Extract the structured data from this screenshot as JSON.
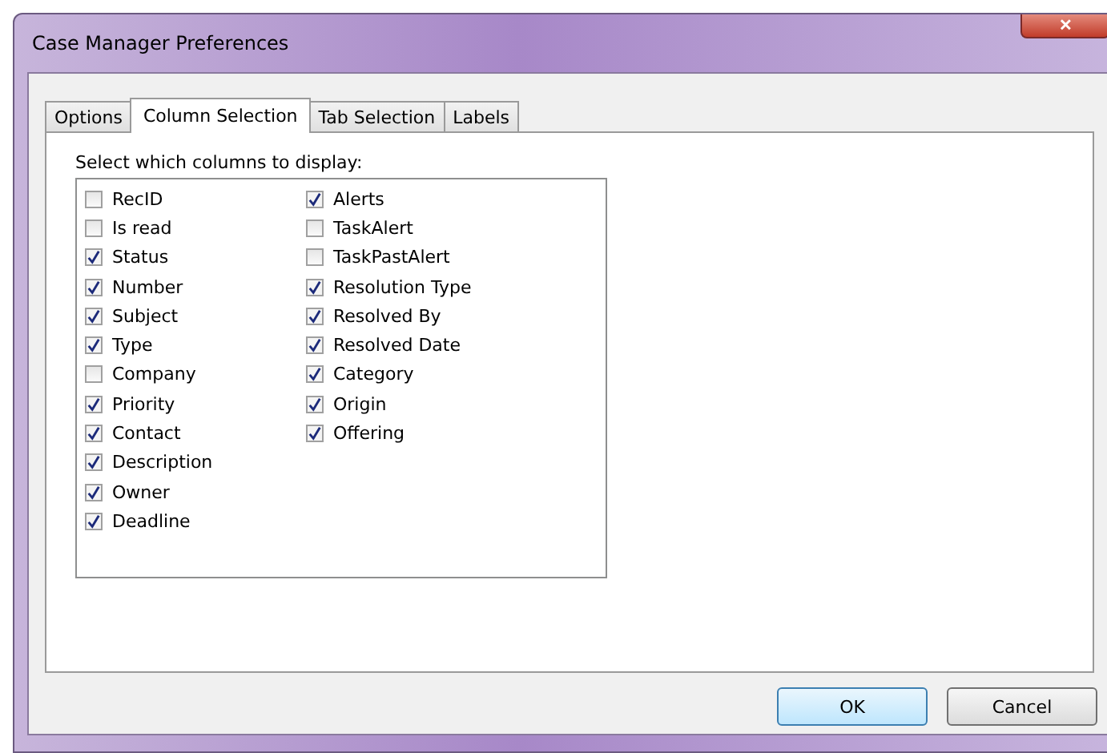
{
  "window": {
    "title": "Case Manager Preferences",
    "close": "✕"
  },
  "tabs": [
    {
      "label": "Options",
      "selected": false
    },
    {
      "label": "Column Selection",
      "selected": true
    },
    {
      "label": "Tab Selection",
      "selected": false
    },
    {
      "label": "Labels",
      "selected": false
    }
  ],
  "prompt": "Select which columns to display:",
  "columns": [
    [
      {
        "label": "RecID",
        "checked": false
      },
      {
        "label": "Is read",
        "checked": false
      },
      {
        "label": "Status",
        "checked": true
      },
      {
        "label": "Number",
        "checked": true
      },
      {
        "label": "Subject",
        "checked": true
      },
      {
        "label": "Type",
        "checked": true
      },
      {
        "label": "Company",
        "checked": false
      },
      {
        "label": "Priority",
        "checked": true
      },
      {
        "label": "Contact",
        "checked": true
      },
      {
        "label": "Description",
        "checked": true
      },
      {
        "label": "Owner",
        "checked": true
      },
      {
        "label": "Deadline",
        "checked": true
      }
    ],
    [
      {
        "label": "Alerts",
        "checked": true
      },
      {
        "label": "TaskAlert",
        "checked": false
      },
      {
        "label": "TaskPastAlert",
        "checked": false
      },
      {
        "label": "Resolution Type",
        "checked": true
      },
      {
        "label": "Resolved By",
        "checked": true
      },
      {
        "label": "Resolved Date",
        "checked": true
      },
      {
        "label": "Category",
        "checked": true
      },
      {
        "label": "Origin",
        "checked": true
      },
      {
        "label": "Offering",
        "checked": true
      }
    ]
  ],
  "buttons": [
    {
      "label": "OK",
      "kind": "default"
    },
    {
      "label": "Cancel",
      "kind": "normal"
    }
  ]
}
